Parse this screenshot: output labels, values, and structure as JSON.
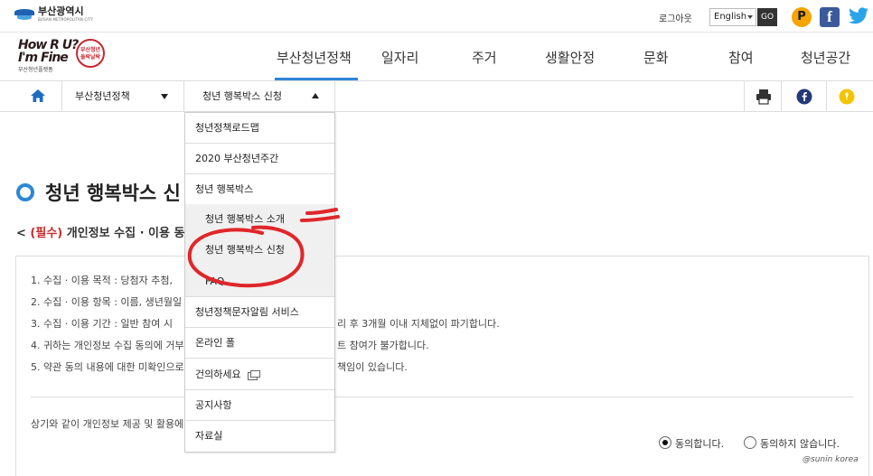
{
  "top": {
    "city_name": "부산광역시",
    "city_sub": "BUSAN METROPOLITAN CITY",
    "logout": "로그아웃",
    "language": "English",
    "go": "GO"
  },
  "site_logo": {
    "line1": "How R U?",
    "line2": "I'm Fine",
    "tagline": "부산청년플랫폼",
    "stamp": "부산청년 들락날락"
  },
  "nav": [
    "부산청년정책",
    "일자리",
    "주거",
    "생활안정",
    "문화",
    "참여",
    "청년공간"
  ],
  "breadcrumb": {
    "level1": "부산청년정책",
    "level2": "청년 행복박스 신청"
  },
  "dropdown": {
    "items": [
      "청년정책로드맵",
      "2020 부산청년주간",
      "청년 행복박스"
    ],
    "sub_items": [
      "청년 행복박스 소개",
      "청년 행복박스 신청",
      "FAQ"
    ],
    "items_after": [
      "청년정책문자알림 서비스",
      "온라인 폴",
      "건의하세요",
      "공지사항",
      "자료실"
    ]
  },
  "content": {
    "page_title": "청년 행복박스 신",
    "heading_prefix": "< ",
    "heading_required": "(필수)",
    "heading_text": " 개인정보 수집  ·  이용 동",
    "lines": [
      "1. 수집 · 이용 목적 : 당첨자 추첨,",
      "2. 수집 · 이용 항목 : 이름, 생년월일",
      "3. 수집 · 이용 기간 : 일반 참여 시",
      "4. 귀하는 개인정보 수집 동의에 거부",
      "5. 약관 동의 내용에 대한 미확인으로"
    ],
    "line3_tail": "리 후 3개월 이내 지체없이 파기합니다.",
    "line4_tail": "트 참여가 불가합니다.",
    "line5_tail": "책임이 있습니다.",
    "agree_question": "상기와 같이 개인정보 제공 및 활용에",
    "agree": "동의합니다.",
    "disagree": "동의하지 않습니다.",
    "agree_selected": true
  },
  "watermark": "@sunin korea",
  "colors": {
    "accent": "#2f86d6",
    "required": "#c82a2a",
    "scribble": "#e0262a"
  }
}
